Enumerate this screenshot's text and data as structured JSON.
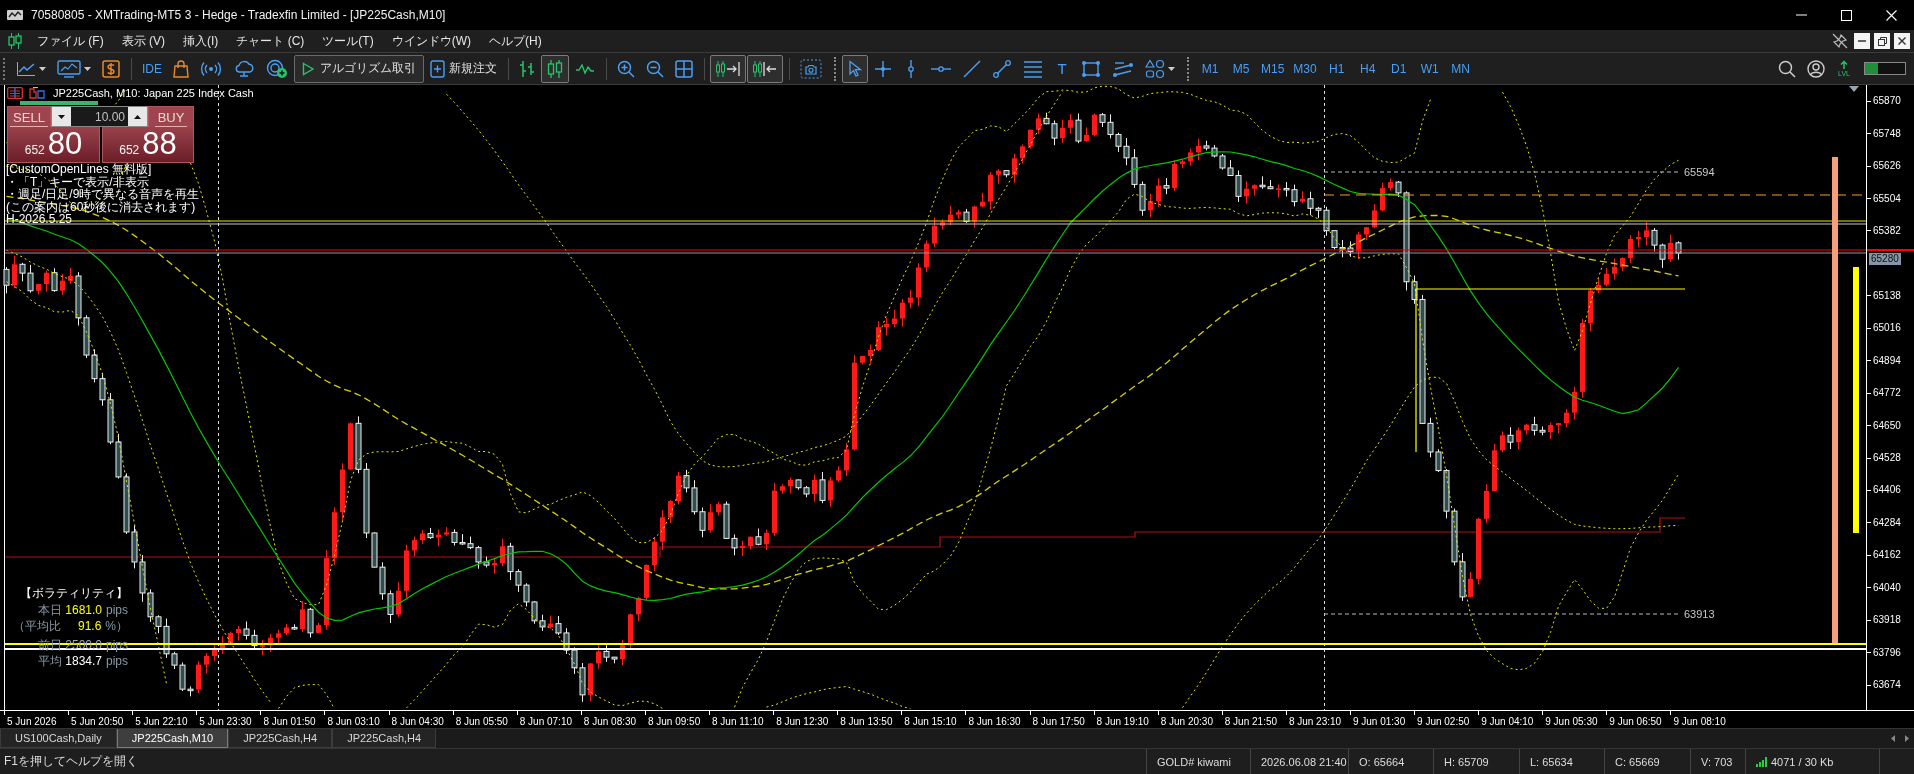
{
  "window": {
    "title": "70580805 - XMTrading-MT5 3 - Hedge - Tradexfin Limited - [JP225Cash,M10]"
  },
  "menu": [
    "ファイル (F)",
    "表示 (V)",
    "挿入(I)",
    "チャート (C)",
    "ツール(T)",
    "ウインドウ(W)",
    "ヘルプ(H)"
  ],
  "toolbar": {
    "ide": "IDE",
    "algo_trading": "アルゴリズム取引",
    "new_order": "新規注文",
    "chart_types": [
      {
        "selected": false
      },
      {
        "selected": true
      },
      {
        "selected": false
      }
    ],
    "auto_scroll": {
      "on": true
    },
    "chart_shift": {
      "on": true
    },
    "tools": [
      {
        "selected": true
      },
      {
        "selected": false
      },
      {
        "selected": false
      },
      {
        "selected": false
      },
      {
        "selected": false
      },
      {
        "selected": false
      },
      {
        "selected": false
      },
      {
        "label": "T",
        "selected": false
      },
      {
        "selected": false
      },
      {
        "selected": false
      },
      {
        "selected": false
      }
    ],
    "timeframes": [
      {
        "label": "M1",
        "selected": false
      },
      {
        "label": "M5",
        "selected": false
      },
      {
        "label": "M15",
        "selected": false
      },
      {
        "label": "M30",
        "selected": false
      },
      {
        "label": "H1",
        "selected": false
      },
      {
        "label": "H4",
        "selected": false
      },
      {
        "label": "D1",
        "selected": false
      },
      {
        "label": "W1",
        "selected": false
      },
      {
        "label": "MN",
        "selected": false
      }
    ],
    "level_badge": "LVL",
    "level_meter": {
      "level": 0.33
    }
  },
  "chart": {
    "symbol": "JP225Cash, M10: Japan 225 Index Cash",
    "one_click": {
      "sell": {
        "label": "SELL",
        "price_prefix": "652",
        "price_main": "80"
      },
      "volume": "10.00",
      "buy": {
        "label": "BUY",
        "price_prefix": "652",
        "price_main": "88"
      }
    },
    "notice": [
      "[CustomOpenLines 無料版]",
      "・「T」キーで表示/非表示",
      "・週足/日足/9時で異なる音声を再生",
      "(この案内は60秒後に消去されます)",
      "H-2026.5.25"
    ],
    "volatility": {
      "title": "【ボラティリティ】",
      "rows": [
        {
          "label": "本日",
          "value": "1681.0",
          "unit": "pips",
          "kind": "accent"
        },
        {
          "label": "（平均比",
          "value": "91.6",
          "unit": "%）",
          "kind": "accent"
        },
        {
          "label": "前日",
          "value": "2500.0",
          "unit": "pips",
          "kind": "muted"
        },
        {
          "label": "平均",
          "value": "1834.7",
          "unit": "pips",
          "kind": "bright"
        }
      ]
    },
    "level_labels": [
      "65594",
      "63913"
    ],
    "price_axis": {
      "upper": [
        "65870",
        "65748",
        "65626",
        "65504",
        "65382"
      ],
      "current": "65280",
      "lower": [
        "65138",
        "65016",
        "64894",
        "64772",
        "64650",
        "64528",
        "64406",
        "64284",
        "64162",
        "64040",
        "63918",
        "63796",
        "63674"
      ]
    },
    "time_axis": [
      "5 Jun 2026",
      "5 Jun 20:50",
      "5 Jun 22:10",
      "5 Jun 23:30",
      "8 Jun 01:50",
      "8 Jun 03:10",
      "8 Jun 04:30",
      "8 Jun 05:50",
      "8 Jun 07:10",
      "8 Jun 08:30",
      "8 Jun 09:50",
      "8 Jun 11:10",
      "8 Jun 12:30",
      "8 Jun 13:50",
      "8 Jun 15:10",
      "8 Jun 16:30",
      "8 Jun 17:50",
      "8 Jun 19:10",
      "8 Jun 20:30",
      "8 Jun 21:50",
      "8 Jun 23:10",
      "9 Jun 01:30",
      "9 Jun 02:50",
      "9 Jun 04:10",
      "9 Jun 05:30",
      "9 Jun 06:50",
      "9 Jun 08:10"
    ]
  },
  "tabs": [
    {
      "label": "US100Cash,Daily",
      "selected": false
    },
    {
      "label": "JP225Cash,M10",
      "selected": true
    },
    {
      "label": "JP225Cash,H4",
      "selected": false
    },
    {
      "label": "JP225Cash,H4",
      "selected": false
    }
  ],
  "status_bar": {
    "help": "F1を押してヘルプを開く",
    "cells": [
      "GOLD# kiwami",
      "2026.06.08 21:40",
      "O: 65664",
      "H: 65709",
      "L: 65634",
      "C: 65669",
      "V: 703"
    ],
    "traffic": "4071 / 30 Kb"
  }
}
